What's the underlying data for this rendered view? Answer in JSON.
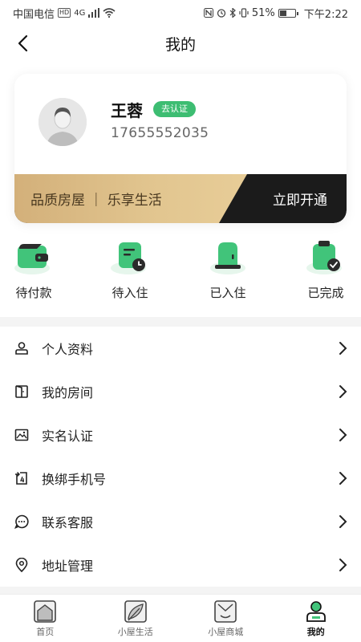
{
  "status_bar": {
    "carrier": "中国电信",
    "hd": "HD",
    "network": "4G",
    "battery_pct": "51%",
    "battery_level": 0.51,
    "time": "下午2:22"
  },
  "header": {
    "title": "我的"
  },
  "profile": {
    "name": "王蓉",
    "verify_badge": "去认证",
    "phone": "17655552035"
  },
  "vip_banner": {
    "slogan": "品质房屋 ｜ 乐享生活",
    "cta": "立即开通"
  },
  "orders": [
    {
      "label": "待付款",
      "icon": "wallet-icon"
    },
    {
      "label": "待入住",
      "icon": "pending-checkin-icon"
    },
    {
      "label": "已入住",
      "icon": "door-icon"
    },
    {
      "label": "已完成",
      "icon": "completed-clipboard-icon"
    }
  ],
  "menu": [
    {
      "label": "个人资料",
      "icon": "person-icon"
    },
    {
      "label": "我的房间",
      "icon": "room-door-icon"
    },
    {
      "label": "实名认证",
      "icon": "id-image-icon"
    },
    {
      "label": "换绑手机号",
      "icon": "phone-rebind-icon"
    },
    {
      "label": "联系客服",
      "icon": "chat-bubble-icon"
    },
    {
      "label": "地址管理",
      "icon": "location-pin-icon"
    }
  ],
  "tabs": [
    {
      "label": "首页",
      "icon": "home-icon",
      "active": false
    },
    {
      "label": "小屋生活",
      "icon": "leaf-icon",
      "active": false
    },
    {
      "label": "小屋商城",
      "icon": "shop-icon",
      "active": false
    },
    {
      "label": "我的",
      "icon": "user-profile-icon",
      "active": true
    }
  ],
  "colors": {
    "accent_green": "#3dbd72",
    "gold": "#d9b985",
    "dark": "#1b1b1b"
  }
}
